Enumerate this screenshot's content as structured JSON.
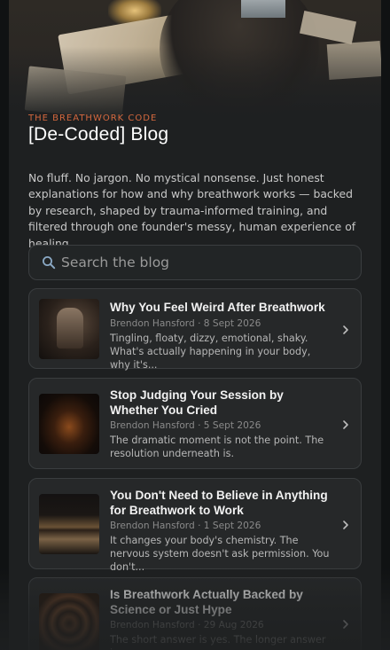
{
  "header": {
    "eyebrow": "THE BREATHWORK CODE",
    "title": "[De-Coded] Blog",
    "intro": "No fluff. No jargon. No mystical nonsense. Just honest explanations for how and why breathwork works — backed by research, shaped by trauma-informed training, and filtered through one founder's messy, human experience of healing."
  },
  "search": {
    "placeholder": "Search the blog",
    "icon": "search-icon"
  },
  "posts": [
    {
      "title": "Why You Feel Weird After Breathwork",
      "meta": "Brendon Hansford · 8 Sept 2026",
      "excerpt": "Tingling, floaty, dizzy, emotional, shaky. What's actually happening in your body, why it's..."
    },
    {
      "title": "Stop Judging Your Session by Whether You Cried",
      "meta": "Brendon Hansford · 5 Sept 2026",
      "excerpt": "The dramatic moment is not the point. The resolution underneath is."
    },
    {
      "title": "You Don't Need to Believe in Anything for Breathwork to Work",
      "meta": "Brendon Hansford · 1 Sept 2026",
      "excerpt": "It changes your body's chemistry. The nervous system doesn't ask permission. You don't..."
    },
    {
      "title": "Is Breathwork Actually Backed by Science or Just Hype",
      "meta": "Brendon Hansford · 29 Aug 2026",
      "excerpt": "The short answer is yes. The longer answer is..."
    }
  ],
  "colors": {
    "accent": "#d4683e",
    "background": "#1e2021",
    "card": "#262829"
  }
}
